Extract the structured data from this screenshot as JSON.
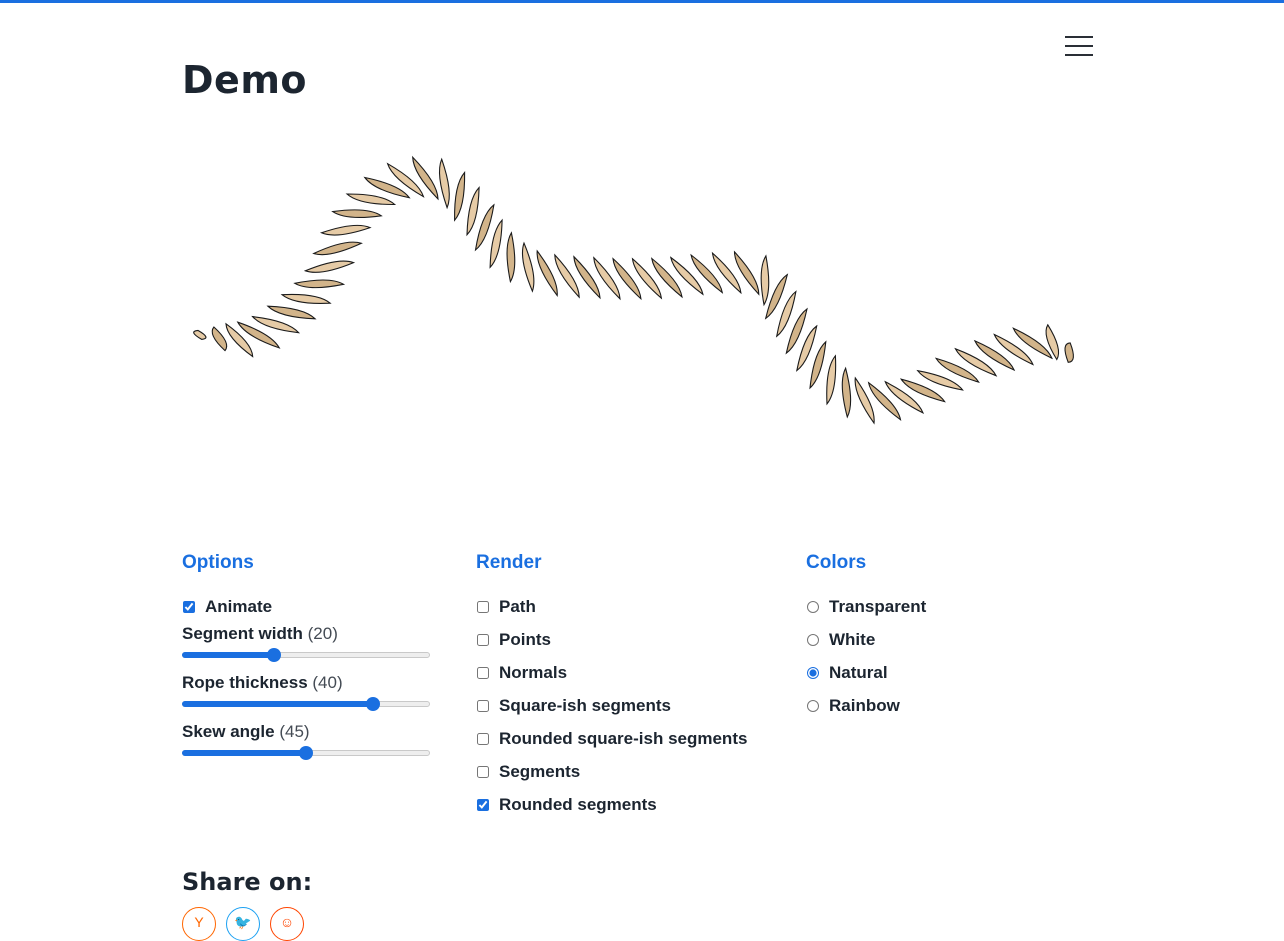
{
  "page": {
    "title": "Demo",
    "accent_color": "#1a6fe0"
  },
  "options": {
    "heading": "Options",
    "animate": {
      "label": "Animate",
      "checked": true
    },
    "sliders": [
      {
        "label": "Segment width",
        "value_text": "(20)",
        "fraction": 0.37
      },
      {
        "label": "Rope thickness",
        "value_text": "(40)",
        "fraction": 0.77
      },
      {
        "label": "Skew angle",
        "value_text": "(45)",
        "fraction": 0.5
      }
    ]
  },
  "render": {
    "heading": "Render",
    "items": [
      {
        "label": "Path",
        "checked": false
      },
      {
        "label": "Points",
        "checked": false
      },
      {
        "label": "Normals",
        "checked": false
      },
      {
        "label": "Square-ish segments",
        "checked": false
      },
      {
        "label": "Rounded square-ish segments",
        "checked": false
      },
      {
        "label": "Segments",
        "checked": false
      },
      {
        "label": "Rounded segments",
        "checked": true
      }
    ]
  },
  "colors": {
    "heading": "Colors",
    "items": [
      {
        "label": "Transparent",
        "checked": false
      },
      {
        "label": "White",
        "checked": false
      },
      {
        "label": "Natural",
        "checked": true
      },
      {
        "label": "Rainbow",
        "checked": false
      }
    ],
    "rope_natural_light": "#e6cba6",
    "rope_natural_dark": "#d2b48a"
  },
  "share": {
    "title": "Share on:",
    "buttons": [
      {
        "icon": "hacker-news-icon",
        "glyph": "Y",
        "color": "#ff6600"
      },
      {
        "icon": "twitter-icon",
        "glyph": "🐦",
        "color": "#1da1f2"
      },
      {
        "icon": "reddit-icon",
        "glyph": "☺",
        "color": "#ff4500"
      }
    ]
  }
}
